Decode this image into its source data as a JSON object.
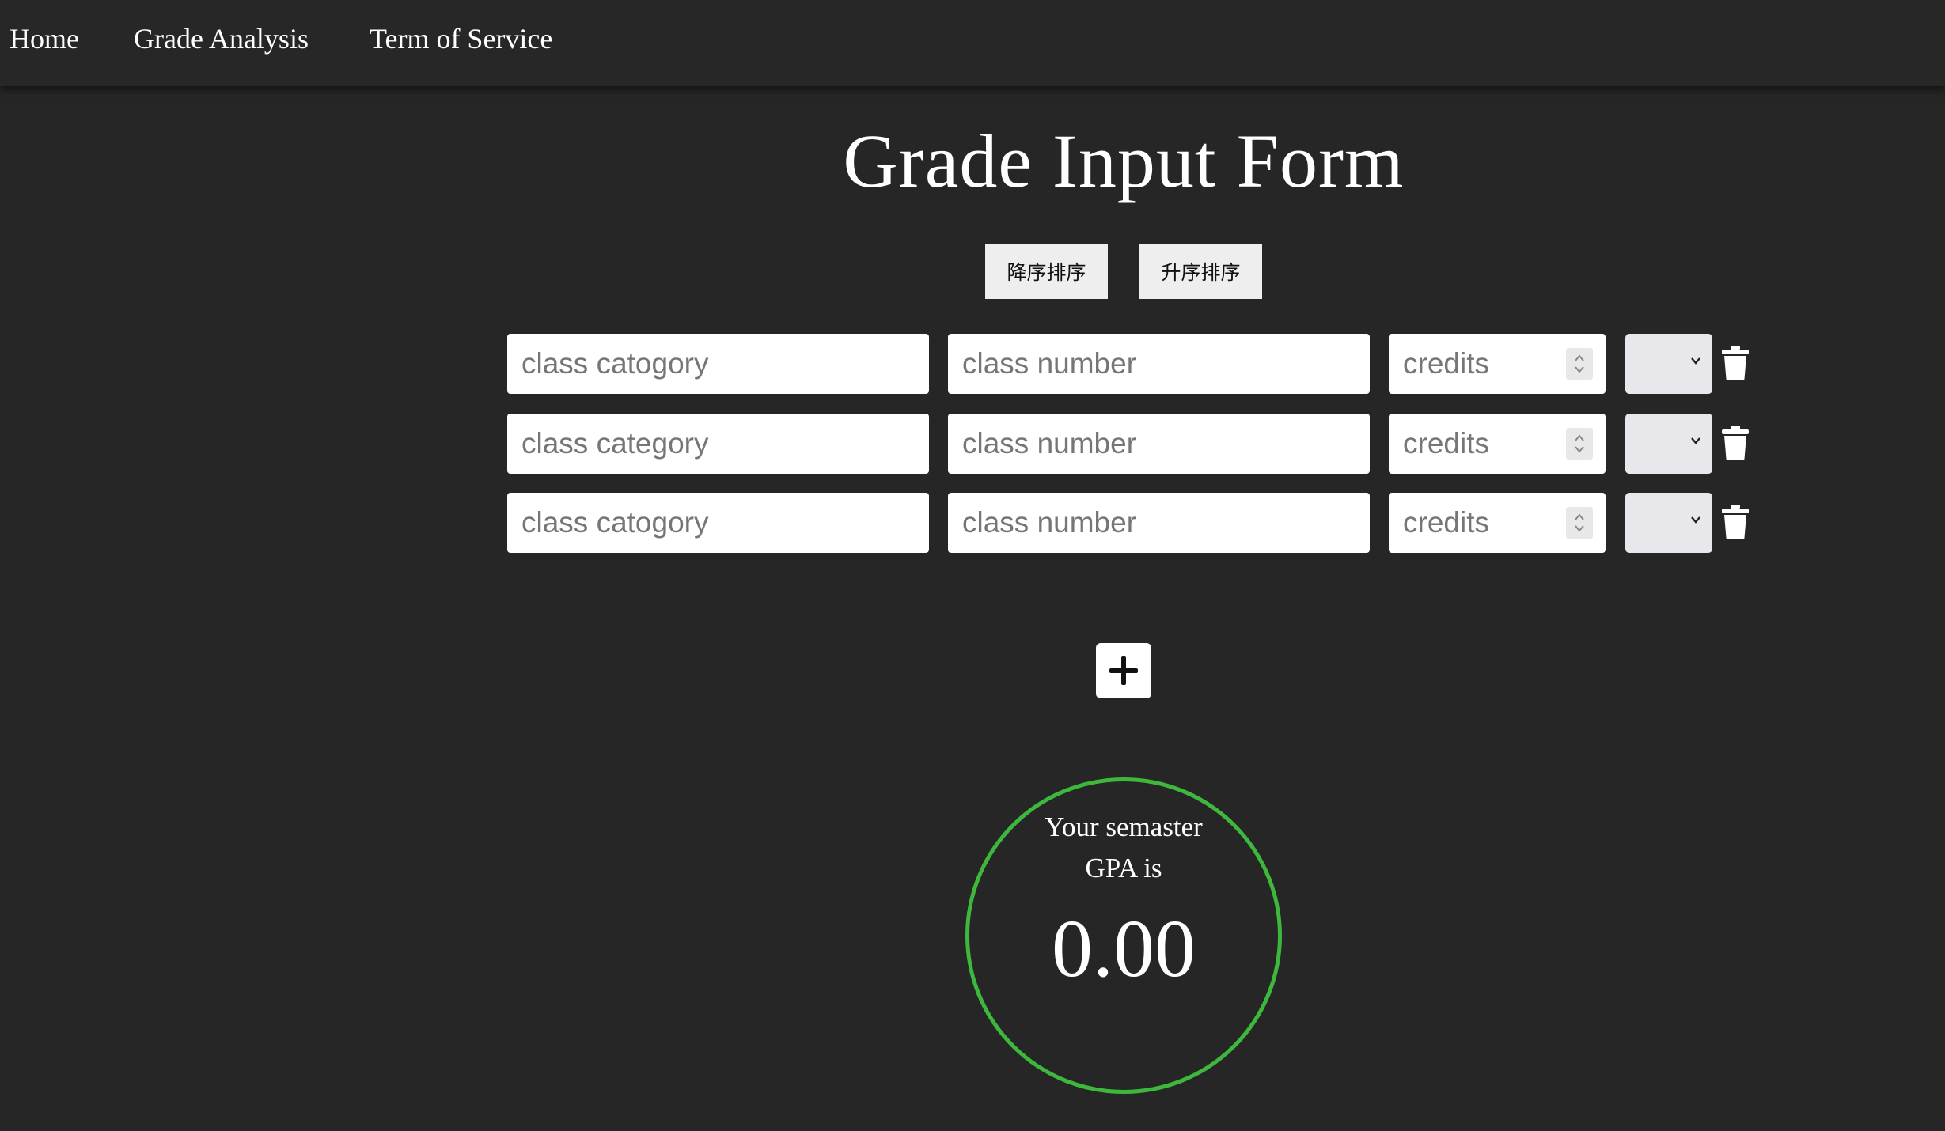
{
  "nav": {
    "home": "Home",
    "grade_analysis": "Grade Analysis",
    "terms": "Term of Service"
  },
  "page_title": "Grade Input Form",
  "sort": {
    "descending": "降序排序",
    "ascending": "升序排序"
  },
  "rows": [
    {
      "category_placeholder": "class catogory",
      "number_placeholder": "class number",
      "credits_placeholder": "credits",
      "grade_value": ""
    },
    {
      "category_placeholder": "class category",
      "number_placeholder": "class number",
      "credits_placeholder": "credits",
      "grade_value": ""
    },
    {
      "category_placeholder": "class catogory",
      "number_placeholder": "class number",
      "credits_placeholder": "credits",
      "grade_value": ""
    }
  ],
  "icons": {
    "delete": "trash-icon",
    "add": "plus-icon",
    "select": "chevron-down-icon",
    "spinner": "spinner-arrows-icon"
  },
  "gpa": {
    "label_line1": "Your semaster",
    "label_line2": "GPA is",
    "value": "0.00"
  },
  "colors": {
    "background": "#262626",
    "navbar": "#272727",
    "gpa_ring": "#3db83d",
    "input_bg": "#ffffff",
    "select_bg": "#e8e8ec"
  }
}
